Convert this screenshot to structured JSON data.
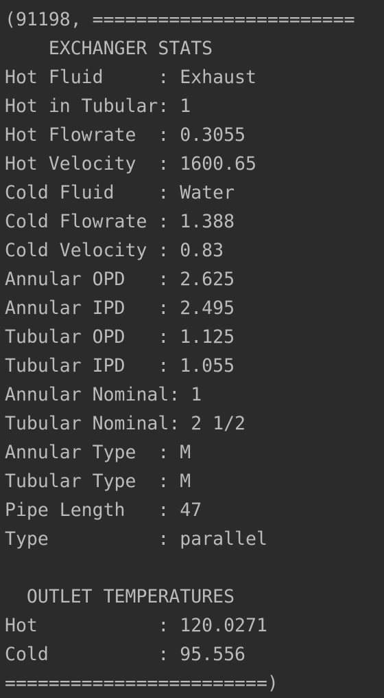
{
  "console": {
    "lines": [
      "(91198, ========================",
      "    EXCHANGER STATS",
      "Hot Fluid     : Exhaust",
      "Hot in Tubular: 1",
      "Hot Flowrate  : 0.3055",
      "Hot Velocity  : 1600.65",
      "Cold Fluid    : Water",
      "Cold Flowrate : 1.388",
      "Cold Velocity : 0.83",
      "Annular OPD   : 2.625",
      "Annular IPD   : 2.495",
      "Tubular OPD   : 1.125",
      "Tubular IPD   : 1.055",
      "Annular Nominal: 1",
      "Tubular Nominal: 2 1/2",
      "Annular Type  : M",
      "Tubular Type  : M",
      "Pipe Length   : 47",
      "Type          : parallel",
      "",
      "  OUTLET TEMPERATURES",
      "Hot           : 120.0271",
      "Cold          : 95.556",
      "========================)"
    ]
  },
  "colors": {
    "background": "#2b2b2b",
    "text": "#bbbbbb"
  }
}
